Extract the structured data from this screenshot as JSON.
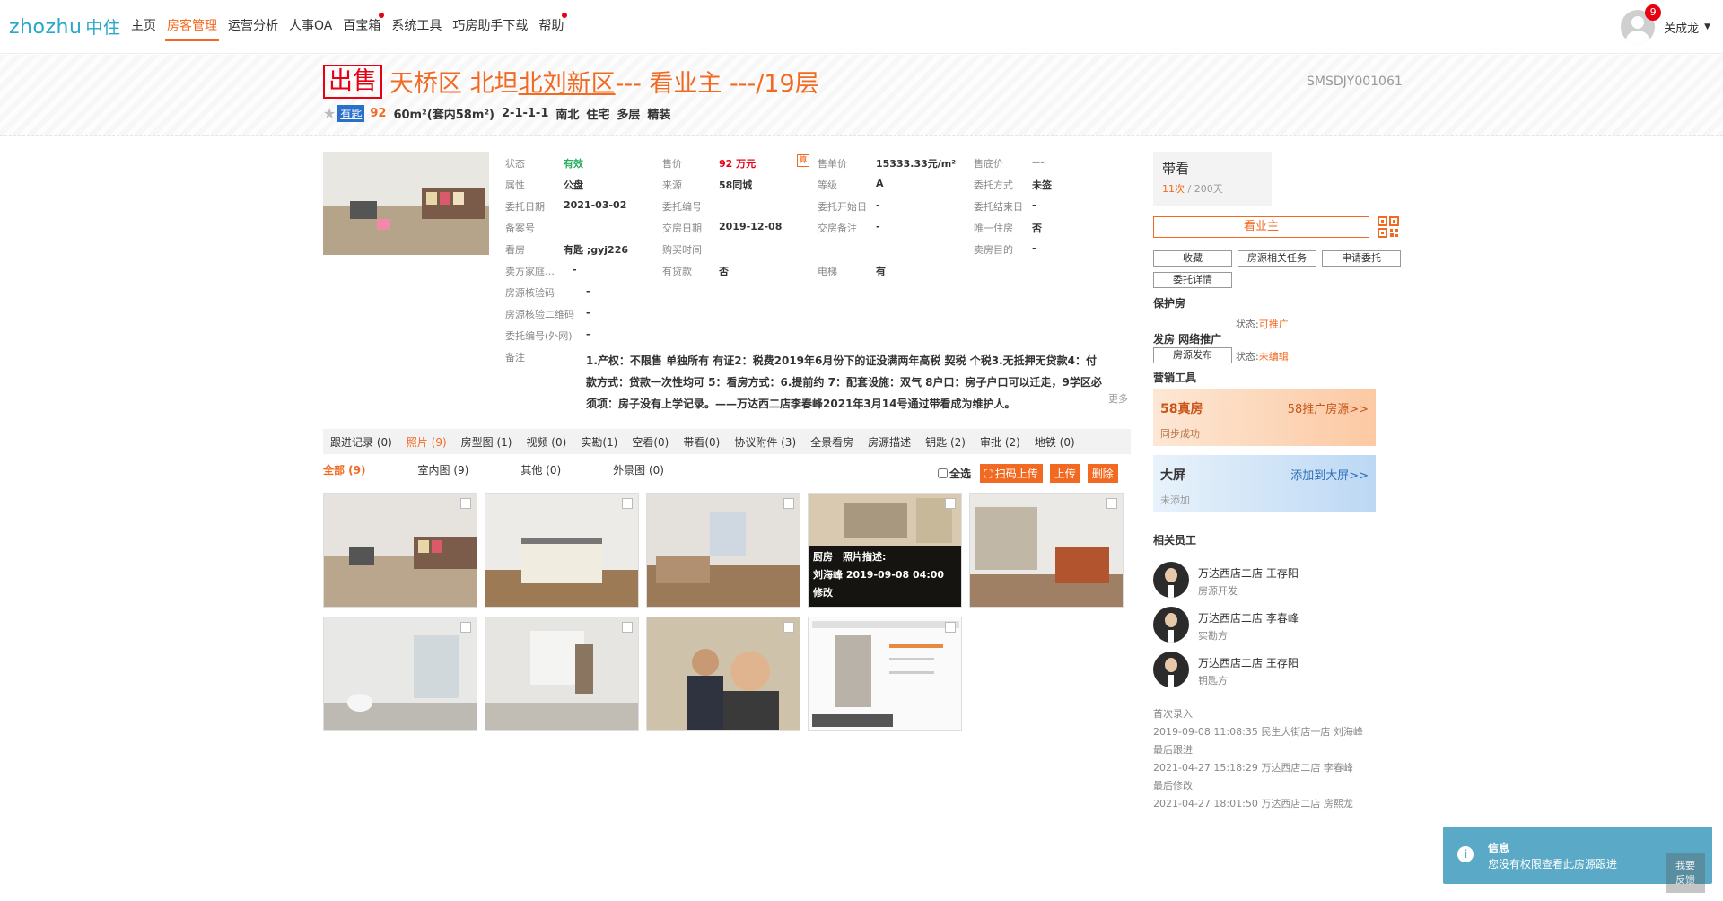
{
  "logo": {
    "text": "zhozhu",
    "cn": "中住"
  },
  "nav": [
    "主页",
    "房客管理",
    "运营分析",
    "人事OA",
    "百宝箱",
    "系统工具",
    "巧房助手下载",
    "帮助"
  ],
  "user": {
    "name": "关成龙",
    "badge": "9"
  },
  "title": {
    "tag": "出售",
    "part1": "天桥区 北坦 ",
    "link": "北刘新区",
    "part2": " --- 看业主 ---/19层",
    "code": "SMSDJY001061"
  },
  "subline": {
    "key": "有匙",
    "num": "92",
    "area": "60m²(套内58m²)",
    "layout": "2-1-1-1",
    "orient": "南北",
    "use": "住宅",
    "floor": "多层",
    "deco": "精装"
  },
  "info": {
    "status_l": "状态",
    "status_v": "有效",
    "price_l": "售价",
    "price_v": "92 万元",
    "unit_l": "售单价",
    "unit_v": "15333.33元/m²",
    "lowest_l": "售底价",
    "lowest_v": "---",
    "prop_l": "属性",
    "prop_v": "公盘",
    "src_l": "来源",
    "src_v": "58同城",
    "grade_l": "等级",
    "grade_v": "A",
    "entrust_l": "委托方式",
    "entrust_v": "未签",
    "edate_l": "委托日期",
    "edate_v": "2021-03-02",
    "eno_l": "委托编号",
    "eno_v": "",
    "estart_l": "委托开始日",
    "estart_v": "-",
    "eend_l": "委托结束日",
    "eend_v": "-",
    "rec_l": "备案号",
    "rec_v": "",
    "deliver_l": "交房日期",
    "deliver_v": "2019-12-08",
    "dnote_l": "交房备注",
    "dnote_v": "-",
    "only_l": "唯一住房",
    "only_v": "否",
    "see_l": "看房",
    "see_v": "有匙 ;gyj226",
    "buy_l": "购买时间",
    "buy_v": "",
    "purpose_l": "卖房目的",
    "purpose_v": "-",
    "family_l": "卖方家庭…",
    "family_v": "-",
    "loan_l": "有贷款",
    "loan_v": "否",
    "elev_l": "电梯",
    "elev_v": "有",
    "vcode_l": "房源核验码",
    "vcode_v": "-",
    "vqr_l": "房源核验二维码",
    "vqr_v": "-",
    "ext_l": "委托编号(外网)",
    "ext_v": "-",
    "remark_l": "备注",
    "remark_v": "1.产权：不限售 单独所有 有证2：税费2019年6月份下的证没满两年高税 契税 个税3.无抵押无贷款4：付款方式：贷款一次性均可 5：看房方式：6.提前约 7：配套设施：双气 8户口：房子户口可以迁走，9学区必须项：房子没有上学记录。——万达西二店李春峰2021年3月14号通过带看成为维护人。",
    "more": "更多",
    "calc": "算"
  },
  "tabs": [
    "跟进记录 (0)",
    "照片 (9)",
    "房型图 (1)",
    "视频 (0)",
    "实勘(1)",
    "空看(0)",
    "带看(0)",
    "协议附件 (3)",
    "全景看房",
    "房源描述",
    "钥匙 (2)",
    "审批 (2)",
    "地铁 (0)"
  ],
  "subtabs": [
    "全部 (9)",
    "室内图 (9)",
    "其他 (0)",
    "外景图 (0)"
  ],
  "photo_actions": {
    "select_all": "全选",
    "scan": "扫码上传",
    "upload": "上传",
    "delete": "删除"
  },
  "overlay": {
    "l1": "厨房　照片描述:",
    "l2": "刘海峰 2019-09-08 04:00",
    "l3": "修改"
  },
  "right": {
    "daikan_t": "带看",
    "daikan_n": "11次",
    "daikan_s": " / 200天",
    "see_owner": "看业主",
    "btn_fav": "收藏",
    "btn_task": "房源相关任务",
    "btn_apply": "申请委托",
    "btn_detail": "委托详情",
    "protect": "保护房",
    "status1_l": "状态:",
    "status1_v": "可推广",
    "publish": "发房 网络推广",
    "btn_publish": "房源发布",
    "status2_l": "状态:",
    "status2_v": "未编辑",
    "tools": "营销工具",
    "c1_t": "58真房",
    "c1_r": "58推广房源>>",
    "c1_s": "同步成功",
    "c2_t": "大屏",
    "c2_r": "添加到大屏>>",
    "c2_s": "未添加",
    "staff": "相关员工",
    "employees": [
      {
        "name": "万达西店二店 王存阳",
        "role": "房源开发"
      },
      {
        "name": "万达西店二店 李春峰",
        "role": "实勘方"
      },
      {
        "name": "万达西店二店 王存阳",
        "role": "钥匙方"
      }
    ],
    "records": [
      "首次录入",
      "2019-09-08 11:08:35 民生大街店一店 刘海峰",
      "最后跟进",
      "2021-04-27 15:18:29 万达西店二店 李春峰",
      "最后修改",
      "2021-04-27 18:01:50 万达西店二店 房熙龙"
    ]
  },
  "toast": {
    "title": "信息",
    "msg": "您没有权限查看此房源跟进",
    "icon": "i"
  },
  "feedback": {
    "l1": "我要",
    "l2": "反馈"
  }
}
